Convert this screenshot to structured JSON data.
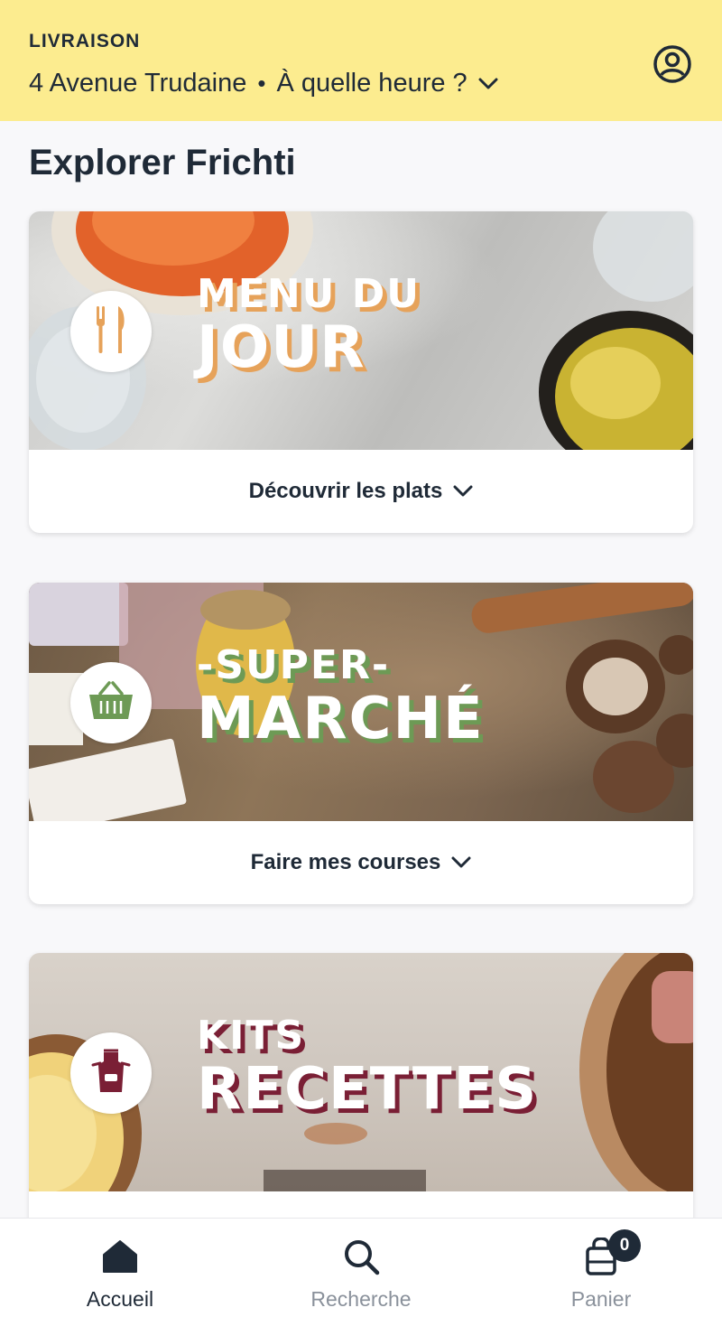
{
  "header": {
    "delivery_label": "LIVRAISON",
    "address": "4 Avenue Trudaine",
    "separator": "•",
    "time_prompt": "À quelle heure ?",
    "background_color": "#fcec8f"
  },
  "page": {
    "title": "Explorer Frichti"
  },
  "cards": [
    {
      "line1": "MENU DU",
      "line2": "JOUR",
      "icon": "cutlery-icon",
      "accent_color": "#e6a25a",
      "action_label": "Découvrir les plats"
    },
    {
      "line1": "-SUPER-",
      "line2": "MARCHÉ",
      "icon": "basket-icon",
      "accent_color": "#6d9a55",
      "action_label": "Faire mes courses"
    },
    {
      "line1": "KITS",
      "line2": "RECETTES",
      "icon": "apron-icon",
      "accent_color": "#7a1f35",
      "action_label": ""
    }
  ],
  "bottom_nav": {
    "items": [
      {
        "label": "Accueil",
        "icon": "home-icon",
        "active": true
      },
      {
        "label": "Recherche",
        "icon": "search-icon",
        "active": false
      },
      {
        "label": "Panier",
        "icon": "shopping-bag-icon",
        "active": false,
        "count": "0"
      }
    ]
  }
}
